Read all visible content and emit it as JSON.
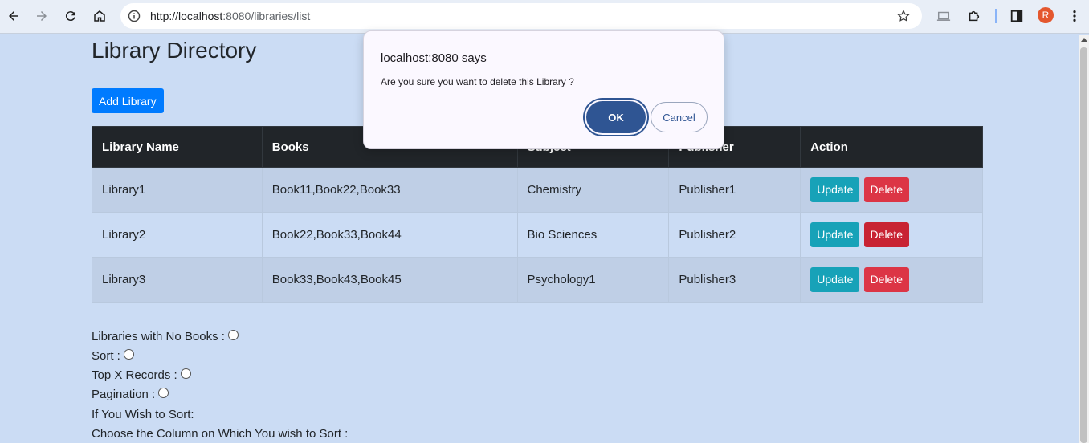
{
  "browser": {
    "url_host": "http://localhost",
    "url_rest": ":8080/libraries/list",
    "profile_initial": "R"
  },
  "page": {
    "title": "Library Directory",
    "add_button": "Add Library",
    "table": {
      "headers": [
        "Library Name",
        "Books",
        "Subject",
        "Publisher",
        "Action"
      ],
      "rows": [
        {
          "name": "Library1",
          "books": "Book11,Book22,Book33",
          "subject": "Chemistry",
          "publisher": "Publisher1"
        },
        {
          "name": "Library2",
          "books": "Book22,Book33,Book44",
          "subject": "Bio Sciences",
          "publisher": "Publisher2"
        },
        {
          "name": "Library3",
          "books": "Book33,Book43,Book45",
          "subject": "Psychology1",
          "publisher": "Publisher3"
        }
      ],
      "update_label": "Update",
      "delete_label": "Delete"
    },
    "options": {
      "no_books": "Libraries with No Books :",
      "sort": "Sort :",
      "top_x": "Top X Records :",
      "pagination": "Pagination :",
      "wish_sort": "If You Wish to Sort:",
      "choose_column": "Choose the Column on Which You wish to Sort :"
    }
  },
  "dialog": {
    "title": "localhost:8080 says",
    "message": "Are you sure you want to delete this Library ?",
    "ok": "OK",
    "cancel": "Cancel"
  },
  "colors": {
    "page_bg": "#cbdcf4",
    "primary": "#007bff",
    "info": "#17a2b8",
    "danger": "#dc3545",
    "dialog_ok": "#2f5593"
  }
}
